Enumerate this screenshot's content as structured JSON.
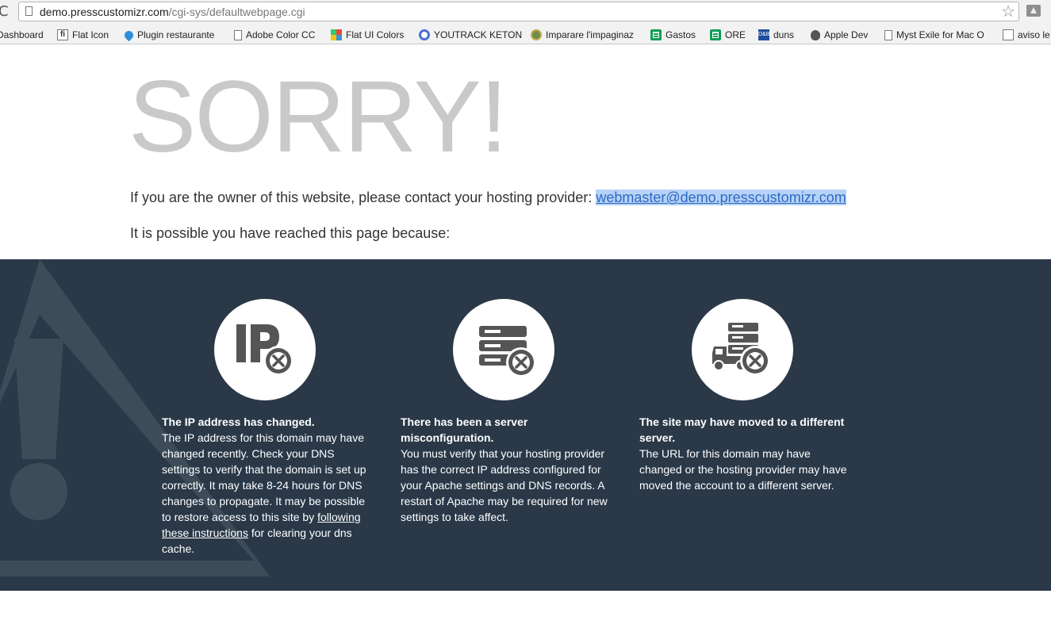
{
  "browser": {
    "reload_glyph": "C",
    "url_host": "demo.presscustomizr.com",
    "url_path": "/cgi-sys/defaultwebpage.cgi",
    "star_glyph": "☆",
    "bookmarks": [
      {
        "label": "Dashboard",
        "icon": "dashboard-icon"
      },
      {
        "label": "Flat Icon",
        "icon": "flat-icon-icon"
      },
      {
        "label": "Plugin restaurante",
        "icon": "drop-icon"
      },
      {
        "label": "Adobe Color CC",
        "icon": "document-icon"
      },
      {
        "label": "Flat UI Colors",
        "icon": "color-grid-icon"
      },
      {
        "label": "YOUTRACK KETON",
        "icon": "youtrack-icon"
      },
      {
        "label": "Imparare l'impaginaz",
        "icon": "globe-icon"
      },
      {
        "label": "Gastos",
        "icon": "spreadsheet-icon"
      },
      {
        "label": "ORE",
        "icon": "spreadsheet-icon"
      },
      {
        "label": "duns",
        "icon": "duns-icon"
      },
      {
        "label": "Apple Dev",
        "icon": "apple-icon"
      },
      {
        "label": "Myst Exile for Mac O",
        "icon": "document-icon"
      },
      {
        "label": "aviso le",
        "icon": "document-icon"
      }
    ]
  },
  "page": {
    "heading": "SORRY!",
    "owner_text": "If you are the owner of this website, please contact your hosting provider: ",
    "owner_email": "webmaster@demo.presscustomizr.com",
    "reason_intro": "It is possible you have reached this page because:",
    "reasons": [
      {
        "icon": "ip-error-icon",
        "title": "The IP address has changed.",
        "body_before": "The IP address for this domain may have changed recently. Check your DNS settings to verify that the domain is set up correctly. It may take 8-24 hours for DNS changes to propagate. It may be possible to restore access to this site by ",
        "link": "following these instructions",
        "body_after": " for clearing your dns cache."
      },
      {
        "icon": "server-error-icon",
        "title": "There has been a server misconfiguration.",
        "body": "You must verify that your hosting provider has the correct IP address configured for your Apache settings and DNS records. A restart of Apache may be required for new settings to take affect."
      },
      {
        "icon": "moved-server-error-icon",
        "title": "The site may have moved to a different server.",
        "body": "The URL for this domain may have changed or the hosting provider may have moved the account to a different server."
      }
    ]
  },
  "colors": {
    "band": "#2a3848",
    "heading": "#c9c9c9",
    "link": "#2f69c2",
    "icon": "#555555"
  }
}
